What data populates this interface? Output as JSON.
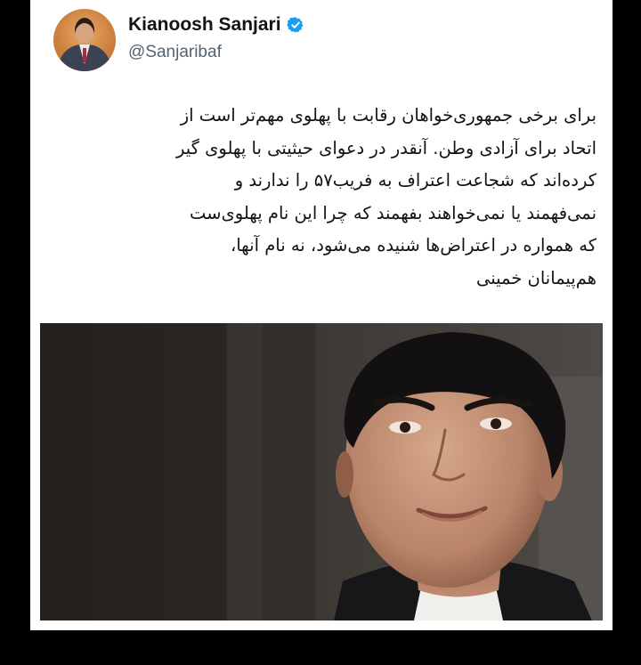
{
  "user": {
    "display_name": "Kianoosh Sanjari",
    "handle": "@Sanjaribaf",
    "verified": true,
    "avatar_icon": "profile-photo-man-in-suit"
  },
  "tweet": {
    "text_lines": [
      "برای برخی جمهوری‌خواهان رقابت با پهلوی مهم‌تر است از",
      "اتحاد برای آزادی وطن. آنقدر در دعوای حیثیتی با پهلوی گیر",
      "کرده‌اند که شجاعت اعتراف به فریب۵۷ را ندارند و",
      "نمی‌فهمند یا نمی‌خواهند بفهمند که چرا این نام پهلوی‌ست",
      "که همواره در اعتراض‌ها شنیده می‌شود، نه نام آنها،",
      "هم‌پیمانان خمینی"
    ]
  },
  "media": {
    "type": "photo",
    "subject_icon": "portrait-photo-man-dark-hair-suit"
  },
  "colors": {
    "page_background": "#000000",
    "card_background": "#ffffff",
    "name_text": "#0f1419",
    "handle_text": "#536471",
    "verified_badge": "#1d9bf0"
  }
}
